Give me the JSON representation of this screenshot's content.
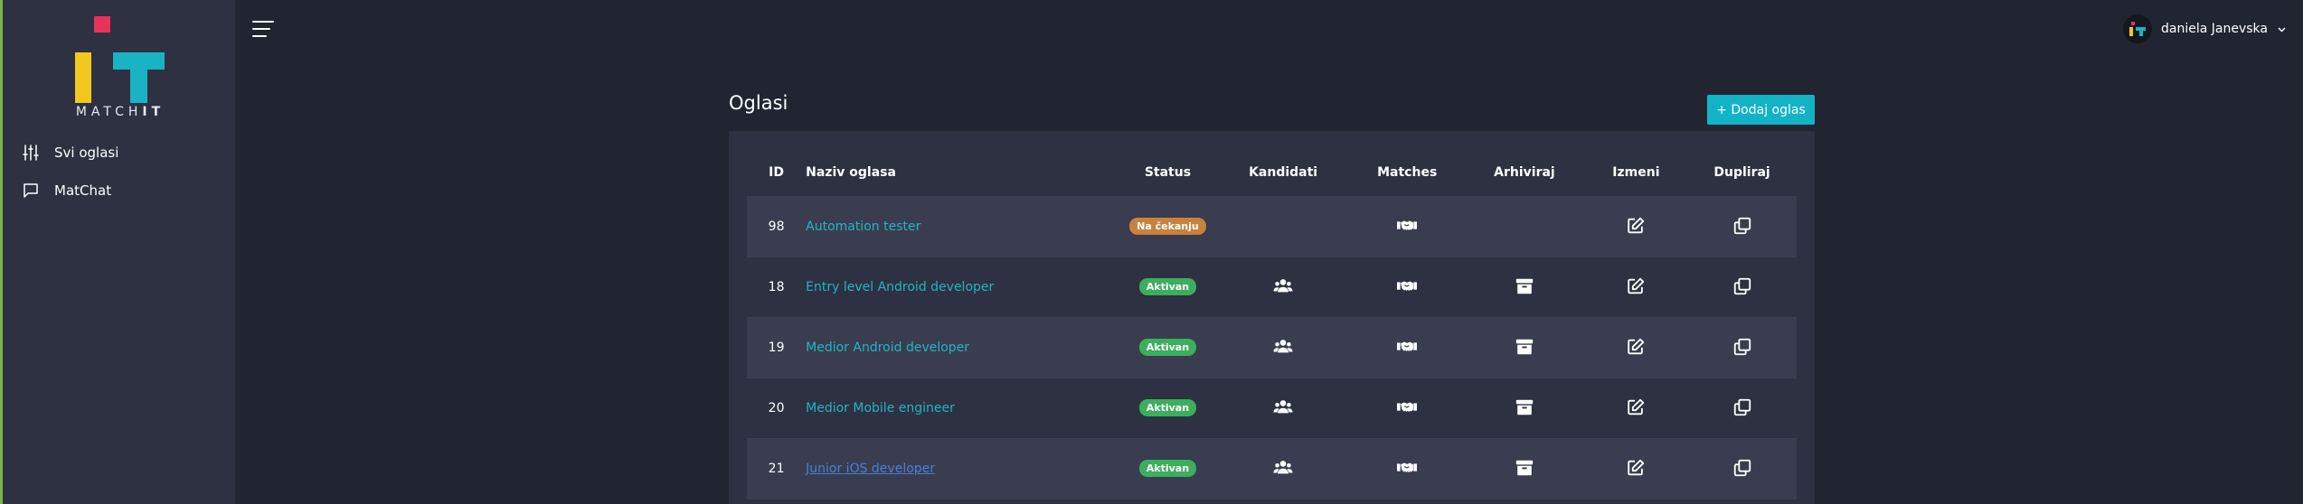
{
  "brand": {
    "name_light": "MATCH",
    "name_bold": "IT"
  },
  "sidebar": {
    "items": [
      {
        "label": "Svi oglasi",
        "icon": "sliders-icon"
      },
      {
        "label": "MatChat",
        "icon": "chat-icon"
      }
    ]
  },
  "header": {
    "user_name": "daniela Janevska"
  },
  "main": {
    "title": "Oglasi",
    "add_button": "+ Dodaj oglas",
    "columns": [
      "ID",
      "Naziv oglasa",
      "Status",
      "Kandidati",
      "Matches",
      "Arhiviraj",
      "Izmeni",
      "Dupliraj"
    ],
    "rows": [
      {
        "id": "98",
        "name": "Automation tester",
        "status": "Na čekanju",
        "status_color": "#c8823d",
        "has_candidates": false,
        "has_archive": false,
        "visited": false
      },
      {
        "id": "18",
        "name": "Entry level Android developer",
        "status": "Aktivan",
        "status_color": "#3cae5c",
        "has_candidates": true,
        "has_archive": true,
        "visited": false
      },
      {
        "id": "19",
        "name": "Medior Android developer",
        "status": "Aktivan",
        "status_color": "#3cae5c",
        "has_candidates": true,
        "has_archive": true,
        "visited": false
      },
      {
        "id": "20",
        "name": "Medior Mobile engineer",
        "status": "Aktivan",
        "status_color": "#3cae5c",
        "has_candidates": true,
        "has_archive": true,
        "visited": false
      },
      {
        "id": "21",
        "name": "Junior iOS developer",
        "status": "Aktivan",
        "status_color": "#3cae5c",
        "has_candidates": true,
        "has_archive": true,
        "visited": true
      }
    ]
  },
  "colors": {
    "accent": "#12b3c7",
    "link": "#23b4c5",
    "sidebar": "#2d3142",
    "background": "#212531"
  }
}
